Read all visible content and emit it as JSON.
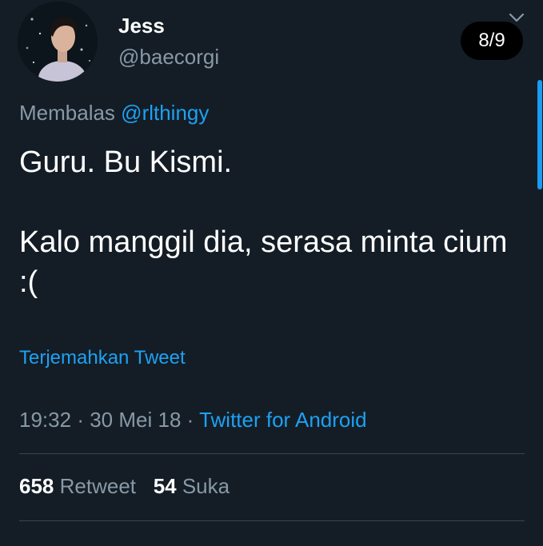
{
  "author": {
    "display_name": "Jess",
    "handle": "@baecorgi"
  },
  "page_badge": "8/9",
  "reply": {
    "prefix": "Membalas",
    "mention": "@rlthingy"
  },
  "tweet": {
    "line1": "Guru. Bu Kismi.",
    "line2": "Kalo manggil dia, serasa minta cium :("
  },
  "translate_label": "Terjemahkan Tweet",
  "meta": {
    "time": "19:32",
    "separator": "·",
    "date": "30 Mei 18",
    "source": "Twitter for Android"
  },
  "stats": {
    "retweet_count": "658",
    "retweet_label": "Retweet",
    "like_count": "54",
    "like_label": "Suka"
  },
  "icons": {
    "chevron": "chevron-down-icon",
    "avatar": "avatar"
  },
  "colors": {
    "background": "#141d26",
    "link": "#1da1f2",
    "secondary_text": "#8899a6",
    "divider": "#38444d"
  }
}
